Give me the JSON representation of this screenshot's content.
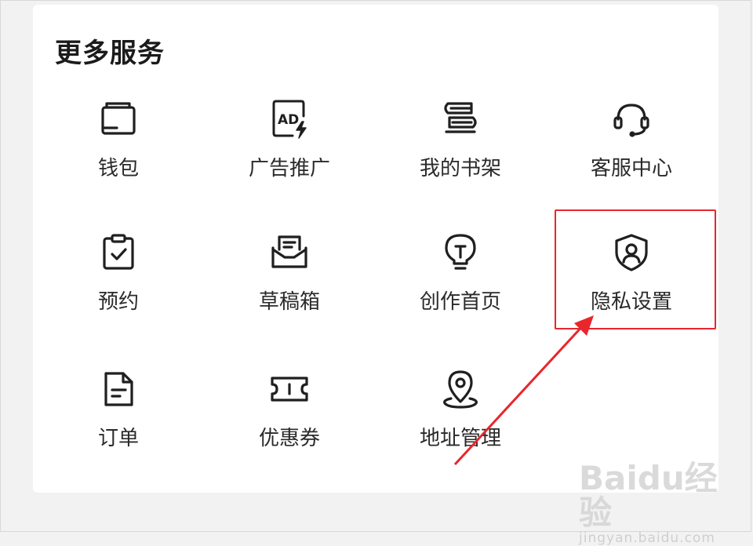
{
  "section": {
    "title": "更多服务"
  },
  "services": [
    {
      "label": "钱包",
      "icon": "wallet-icon"
    },
    {
      "label": "广告推广",
      "icon": "ad-promotion-icon"
    },
    {
      "label": "我的书架",
      "icon": "bookshelf-icon"
    },
    {
      "label": "客服中心",
      "icon": "headset-icon"
    },
    {
      "label": "预约",
      "icon": "clipboard-check-icon"
    },
    {
      "label": "草稿箱",
      "icon": "draft-box-icon"
    },
    {
      "label": "创作首页",
      "icon": "lightbulb-icon"
    },
    {
      "label": "隐私设置",
      "icon": "shield-user-icon"
    },
    {
      "label": "订单",
      "icon": "order-document-icon"
    },
    {
      "label": "优惠券",
      "icon": "coupon-ticket-icon"
    },
    {
      "label": "地址管理",
      "icon": "location-pin-icon"
    }
  ],
  "annotation": {
    "highlight_color": "#e8262b",
    "highlighted_item": "隐私设置"
  },
  "watermark": {
    "logo": "Baidu经验",
    "url": "jingyan.baidu.com"
  }
}
